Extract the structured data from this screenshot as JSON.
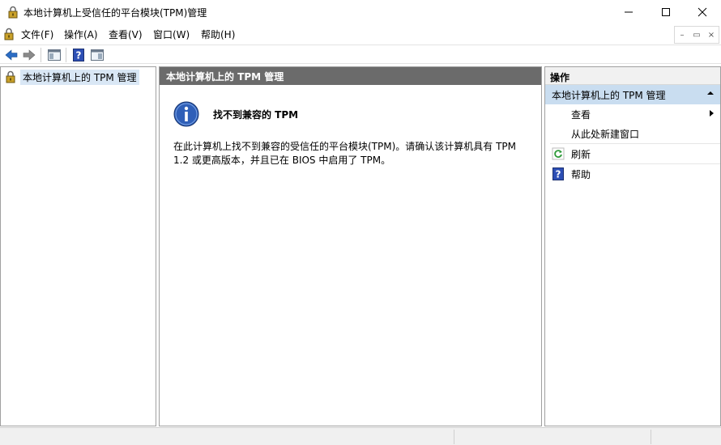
{
  "window": {
    "title": "本地计算机上受信任的平台模块(TPM)管理",
    "controls": {
      "minimize": "—",
      "maximize": "☐",
      "close": "✕"
    }
  },
  "menu": {
    "items": [
      "文件(F)",
      "操作(A)",
      "查看(V)",
      "窗口(W)",
      "帮助(H)"
    ],
    "mdi": {
      "minimize": "–",
      "restore": "▭",
      "close": "×"
    }
  },
  "toolbar": {
    "buttons": [
      "back-icon",
      "forward-icon",
      "show-hide-tree-icon",
      "help-icon",
      "show-hide-action-pane-icon"
    ]
  },
  "tree": {
    "root_label": "本地计算机上的 TPM 管理"
  },
  "center": {
    "header": "本地计算机上的 TPM 管理",
    "info_title": "找不到兼容的 TPM",
    "info_body": "在此计算机上找不到兼容的受信任的平台模块(TPM)。请确认该计算机具有 TPM 1.2 或更高版本，并且已在 BIOS 中启用了 TPM。"
  },
  "actions": {
    "header": "操作",
    "group_label": "本地计算机上的 TPM 管理",
    "items": [
      {
        "label": "查看",
        "icon": "",
        "has_submenu": true
      },
      {
        "label": "从此处新建窗口",
        "icon": ""
      },
      {
        "label": "刷新",
        "icon": "refresh-icon"
      },
      {
        "label": "帮助",
        "icon": "help-icon"
      }
    ]
  },
  "colors": {
    "header_bg": "#6b6b6b",
    "selected_bg": "#d9e7f5",
    "group_bg": "#c9ddf0",
    "accent_blue": "#2b6cc4"
  }
}
